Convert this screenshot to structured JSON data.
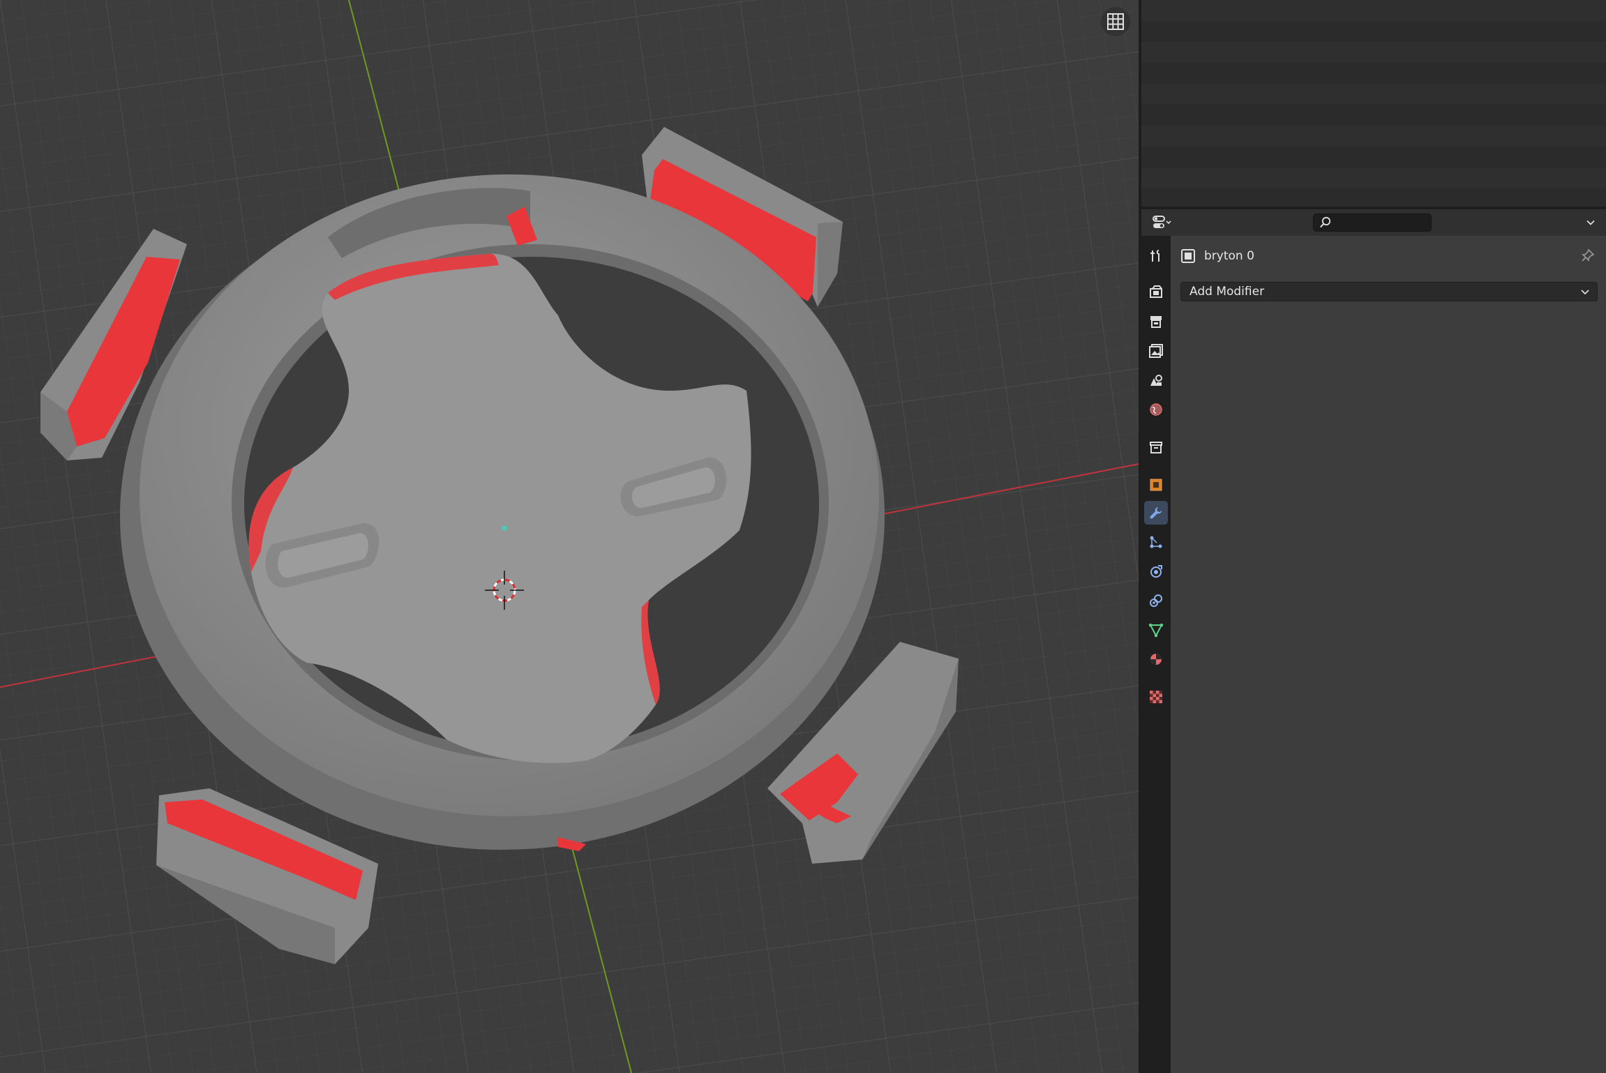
{
  "viewport": {
    "toggle_icon": "grid-icon",
    "axis_colors": {
      "x": "#c2333b",
      "y": "#6f9a1f"
    },
    "mesh_color": "#8c8c8c",
    "highlight_color": "#e8363a"
  },
  "properties": {
    "header": {
      "editor_type_icon": "properties-editor-icon",
      "search_icon": "search-icon",
      "search": {
        "value": "",
        "placeholder": ""
      },
      "options_icon": "chevron-down-icon"
    },
    "tabs": [
      {
        "name": "tool-tab",
        "icon": "tool-icon"
      },
      {
        "name": "render-tab",
        "icon": "render-icon"
      },
      {
        "name": "output-tab",
        "icon": "output-icon"
      },
      {
        "name": "view-layer-tab",
        "icon": "view-layer-icon"
      },
      {
        "name": "scene-tab",
        "icon": "scene-icon"
      },
      {
        "name": "world-tab",
        "icon": "world-icon"
      },
      {
        "name": "collection-tab",
        "icon": "collection-icon"
      },
      {
        "name": "object-tab",
        "icon": "object-icon"
      },
      {
        "name": "modifiers-tab",
        "icon": "wrench-icon",
        "active": true
      },
      {
        "name": "particles-tab",
        "icon": "particles-icon"
      },
      {
        "name": "physics-tab",
        "icon": "physics-icon"
      },
      {
        "name": "constraints-tab",
        "icon": "constraints-icon"
      },
      {
        "name": "data-tab",
        "icon": "mesh-data-icon"
      },
      {
        "name": "material-tab",
        "icon": "material-icon"
      },
      {
        "name": "texture-tab",
        "icon": "texture-icon"
      }
    ],
    "object_name": "bryton 0",
    "add_modifier_label": "Add Modifier"
  }
}
